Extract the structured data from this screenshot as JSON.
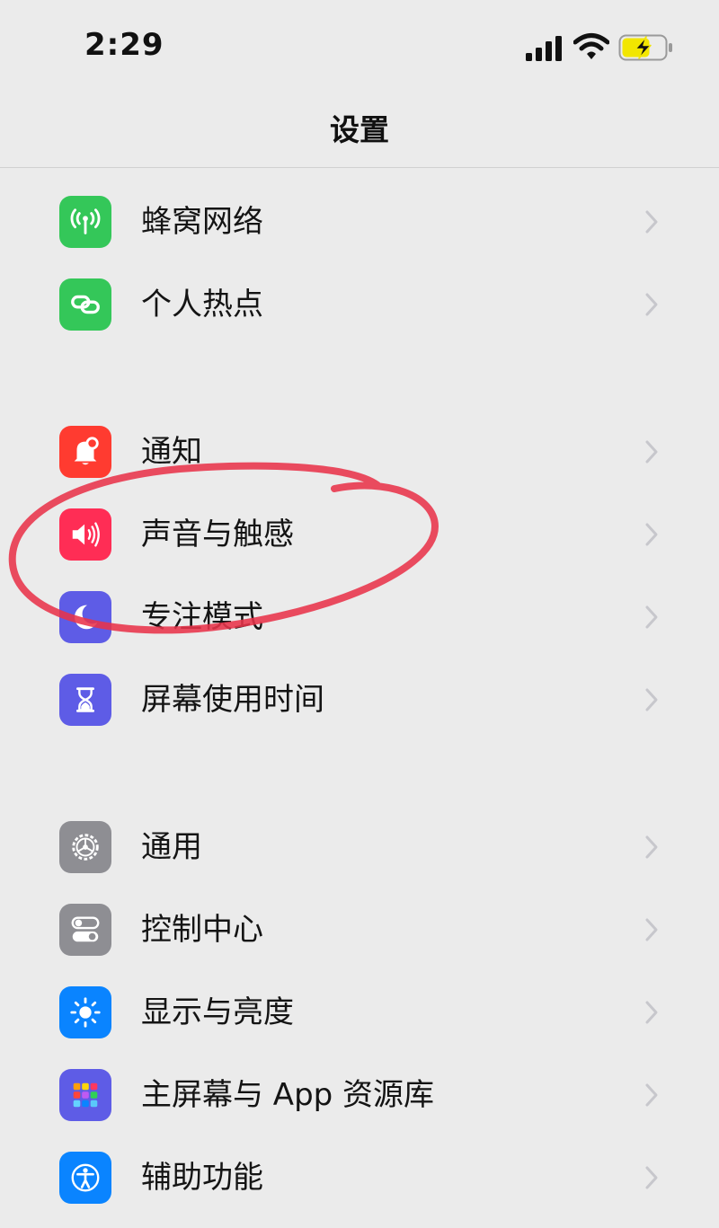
{
  "status_bar": {
    "time": "2:29",
    "signal_icon": "cellular-signal-icon",
    "wifi_icon": "wifi-icon",
    "battery_icon": "battery-charging-icon",
    "battery_color": "#f2e600"
  },
  "nav": {
    "title": "设置"
  },
  "groups": [
    {
      "items": [
        {
          "key": "cellular",
          "label": "蜂窝网络",
          "icon": "antenna-icon",
          "color": "#34c759"
        },
        {
          "key": "hotspot",
          "label": "个人热点",
          "icon": "link-chain-icon",
          "color": "#34c759"
        }
      ]
    },
    {
      "items": [
        {
          "key": "notifications",
          "label": "通知",
          "icon": "bell-icon",
          "color": "#ff3b30"
        },
        {
          "key": "sounds",
          "label": "声音与触感",
          "icon": "speaker-icon",
          "color": "#ff2d55"
        },
        {
          "key": "focus",
          "label": "专注模式",
          "icon": "moon-icon",
          "color": "#5e5ce6"
        },
        {
          "key": "screen-time",
          "label": "屏幕使用时间",
          "icon": "hourglass-icon",
          "color": "#5e5ce6"
        }
      ]
    },
    {
      "items": [
        {
          "key": "general",
          "label": "通用",
          "icon": "gear-icon",
          "color": "#8e8e93"
        },
        {
          "key": "control-center",
          "label": "控制中心",
          "icon": "toggles-icon",
          "color": "#8e8e93"
        },
        {
          "key": "display",
          "label": "显示与亮度",
          "icon": "sun-icon",
          "color": "#0a84ff"
        },
        {
          "key": "home-screen",
          "label": "主屏幕与 App 资源库",
          "icon": "app-grid-icon",
          "color": "#5e5ce6"
        },
        {
          "key": "accessibility",
          "label": "辅助功能",
          "icon": "accessibility-icon",
          "color": "#0a84ff"
        }
      ]
    }
  ],
  "annotation": {
    "shape": "hand-drawn-circle",
    "color": "#e8334a",
    "target": "声音与触感"
  }
}
